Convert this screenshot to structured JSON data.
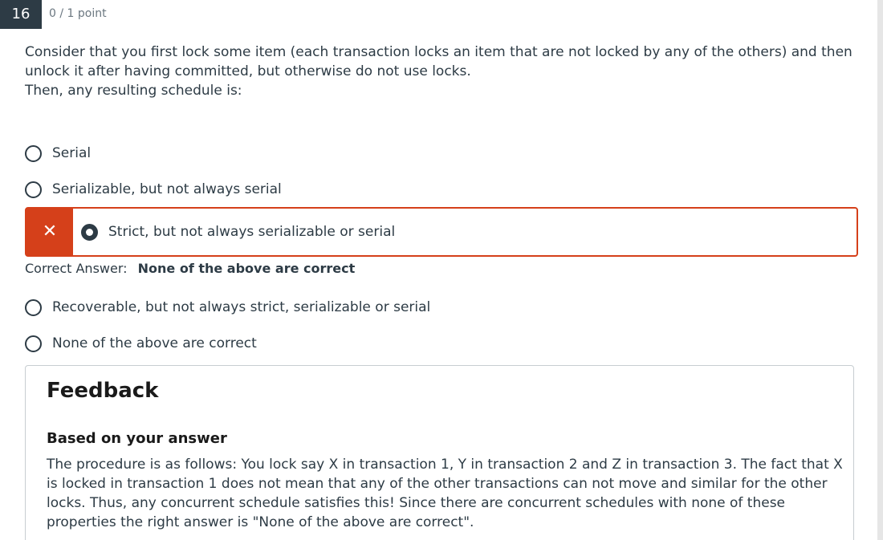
{
  "question": {
    "number": "16",
    "points": "0 / 1 point",
    "text_line1": "Consider that you first lock some item (each transaction locks an item that are not locked by any of the others) and then unlock it after having committed, but otherwise do not use locks.",
    "text_line2": "Then, any resulting schedule is:"
  },
  "options": [
    {
      "label": "Serial"
    },
    {
      "label": "Serializable, but not always serial"
    },
    {
      "label": "Strict, but not always serializable or serial"
    },
    {
      "label": "Recoverable, but not always strict, serializable or serial"
    },
    {
      "label": "None of the above are correct"
    }
  ],
  "selected": {
    "flag_icon": "close-icon",
    "flag_glyph": "✕",
    "status_color": "#d5401a"
  },
  "correct_answer": {
    "label": "Correct Answer:",
    "value": "None of the above are correct"
  },
  "feedback": {
    "title": "Feedback",
    "subtitle": "Based on your answer",
    "body": "The procedure is as follows: You lock say X in transaction 1, Y in transaction 2 and Z in transaction 3. The fact that X is locked in transaction 1 does not mean that any of the other transactions can not move and similar for the other locks. Thus, any concurrent schedule satisfies this! Since there are concurrent schedules with none of these properties the right answer is \"None of the above are correct\"."
  }
}
